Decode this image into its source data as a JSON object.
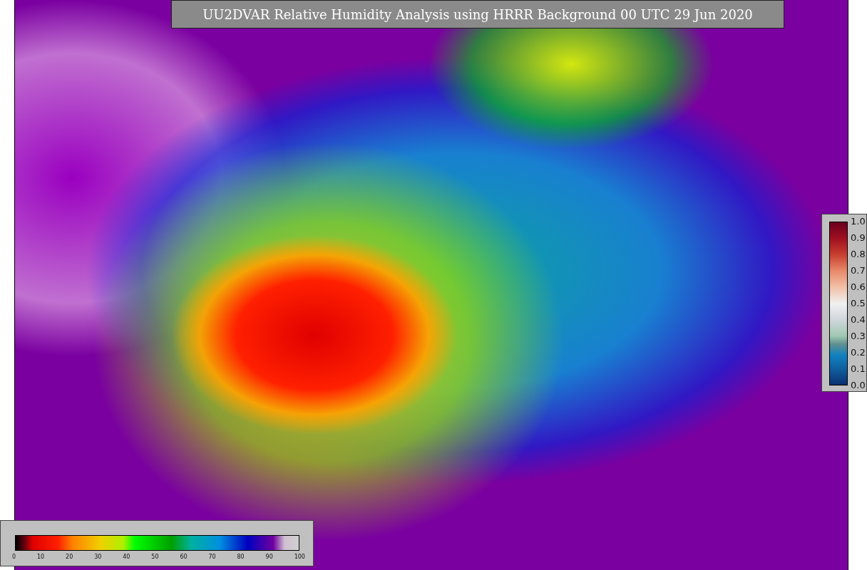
{
  "title": "UU2DVAR Relative Humidity Analysis using HRRR Background 00 UTC 29 Jun 2020",
  "fraction_colorbar": {
    "ticks": [
      "1.0",
      "0.9",
      "0.8",
      "0.7",
      "0.6",
      "0.5",
      "0.4",
      "0.3",
      "0.2",
      "0.1",
      "0.0"
    ]
  },
  "humidity_colorbar": {
    "ticks": [
      "0",
      "10",
      "20",
      "30",
      "40",
      "50",
      "60",
      "70",
      "80",
      "90",
      "100"
    ]
  }
}
